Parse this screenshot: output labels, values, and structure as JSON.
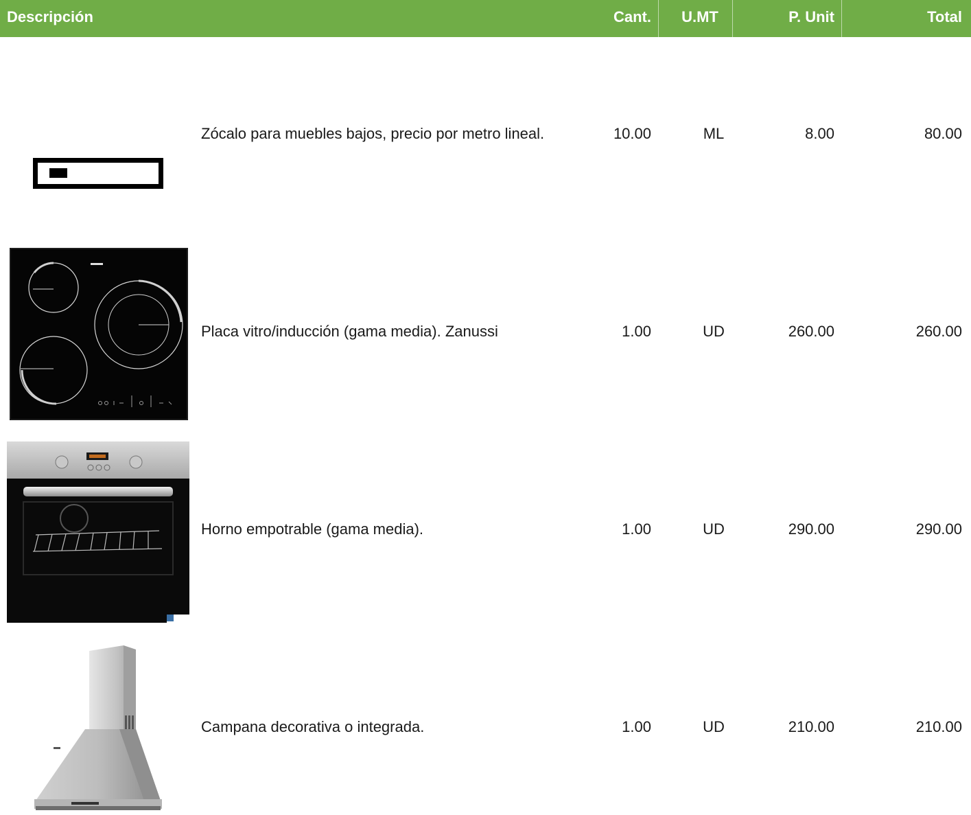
{
  "header": {
    "description": "Descripción",
    "quantity": "Cant.",
    "unit": "U.MT",
    "unit_price": "P. Unit",
    "total": "Total"
  },
  "colors": {
    "header_bg": "#70ad47",
    "header_text": "#ffffff"
  },
  "items": [
    {
      "description": "Zócalo para muebles bajos, precio por metro lineal.",
      "quantity": "10.00",
      "unit": "ML",
      "unit_price": "8.00",
      "total": "80.00",
      "image": "plinth-profile-image"
    },
    {
      "description": "Placa vitro/inducción (gama media). Zanussi",
      "quantity": "1.00",
      "unit": "UD",
      "unit_price": "260.00",
      "total": "260.00",
      "image": "induction-hob-image"
    },
    {
      "description": "Horno empotrable (gama media).",
      "quantity": "1.00",
      "unit": "UD",
      "unit_price": "290.00",
      "total": "290.00",
      "image": "built-in-oven-image"
    },
    {
      "description": "Campana decorativa o integrada.",
      "quantity": "1.00",
      "unit": "UD",
      "unit_price": "210.00",
      "total": "210.00",
      "image": "chimney-hood-image"
    }
  ]
}
